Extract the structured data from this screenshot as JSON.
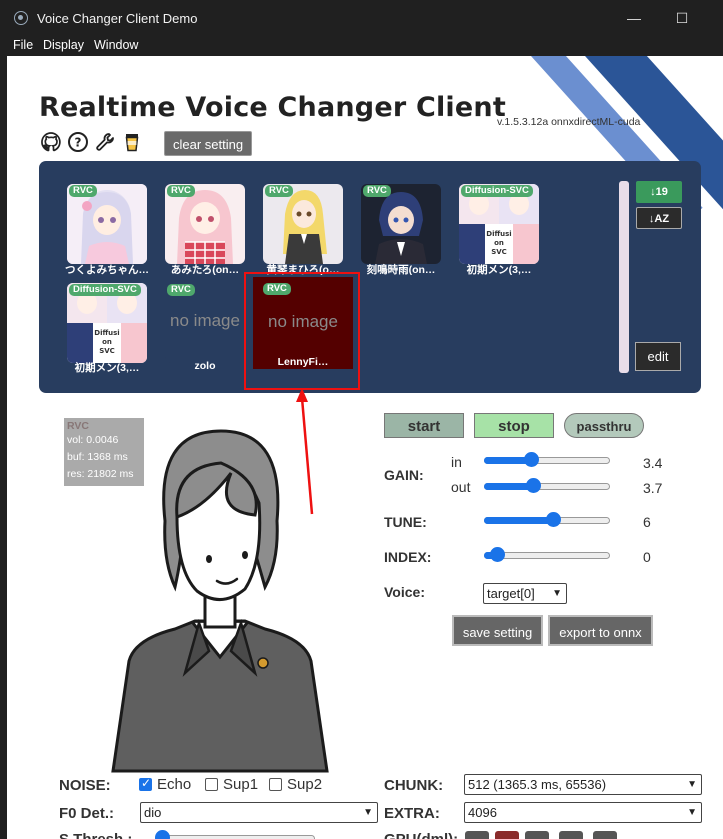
{
  "window": {
    "title": "Voice Changer Client Demo",
    "minimize": "—",
    "maximize": "☐"
  },
  "menu": [
    "File",
    "Display",
    "Window"
  ],
  "header": {
    "title": "Realtime Voice Changer Client",
    "version": "v.1.5.3.12a  onnxdirectML-cuda",
    "icons": [
      "github-icon",
      "help-icon",
      "wrench-icon",
      "coffee-icon"
    ],
    "clear_setting": "clear setting"
  },
  "models": [
    {
      "badge": "RVC",
      "label": "つくよみちゃん…",
      "image": true
    },
    {
      "badge": "RVC",
      "label": "あみたろ(on…",
      "image": true
    },
    {
      "badge": "RVC",
      "label": "黄琴まひろ(o…",
      "image": true
    },
    {
      "badge": "RVC",
      "label": "刻鳴時雨(on…",
      "image": true
    },
    {
      "badge": "Diffusion-SVC",
      "label": "初期メン(3,…",
      "image": true
    },
    {
      "badge": "Diffusion-SVC",
      "label": "初期メン(3,…",
      "image": true
    },
    {
      "badge": "RVC",
      "label": "zolo",
      "image": false,
      "placeholder": "no image"
    },
    {
      "badge": "RVC",
      "label": "LennyFi…",
      "image": false,
      "placeholder": "no image",
      "selected": true
    }
  ],
  "model_panel": {
    "sort_asc": "↓19",
    "sort_alpha": "↓AZ",
    "edit": "edit"
  },
  "stats": {
    "kind": "RVC",
    "vol": "vol: 0.0046",
    "buf": "buf: 1368 ms",
    "res": "res: 21802 ms"
  },
  "controls": {
    "start": "start",
    "stop": "stop",
    "passthru": "passthru",
    "gain_label": "GAIN:",
    "in_label": "in",
    "out_label": "out",
    "gain_in": "3.4",
    "gain_out": "3.7",
    "tune_label": "TUNE:",
    "tune": "6",
    "index_label": "INDEX:",
    "index": "0",
    "voice_label": "Voice:",
    "voice": "target[0]",
    "save_setting": "save setting",
    "export_onnx": "export to onnx"
  },
  "sliders": {
    "gain_in_fraction": 0.36,
    "gain_out_fraction": 0.38,
    "tune_fraction": 0.56,
    "index_fraction": 0.05
  },
  "bottom": {
    "noise_label": "NOISE:",
    "echo": "Echo",
    "sup1": "Sup1",
    "sup2": "Sup2",
    "chunk_label": "CHUNK:",
    "chunk": "512 (1365.3 ms, 65536)",
    "f0_label": "F0 Det.:",
    "f0": "dio",
    "extra_label": "EXTRA:",
    "extra": "4096",
    "sthresh_label": "S.Thresh.:",
    "gpu_label": "GPU(dml):"
  },
  "colors": {
    "panel": "#283d5f",
    "start_button": "#9bb5a6",
    "stop_button": "#a7e2a7",
    "passthru_button": "#b3c9bb",
    "accent": "#1a73e8",
    "highlight": "#ee1111"
  }
}
